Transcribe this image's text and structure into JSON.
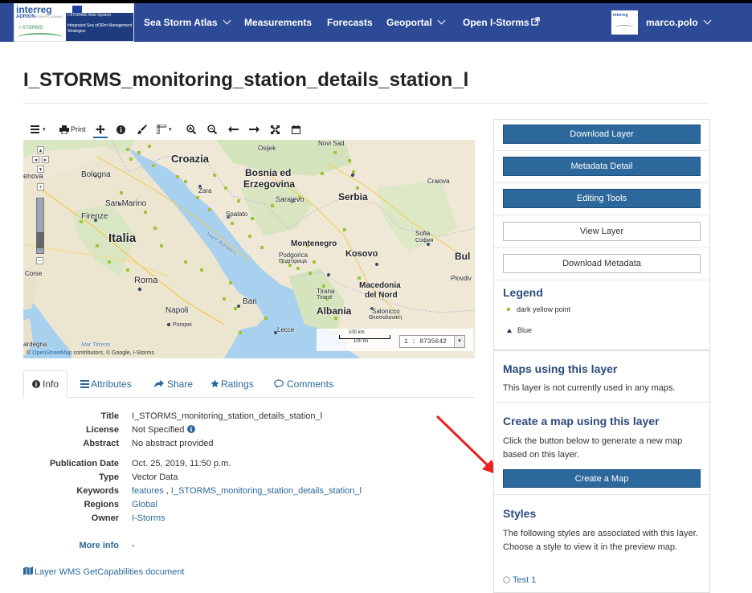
{
  "nav": {
    "logo": {
      "interreg": "interreg",
      "adrion": "ADRION",
      "adrion_sub": "ADRIATIC-IONIAN",
      "istorms": "I-STORMS",
      "line1": "I-STORMS Web System",
      "line2": "Integrated Sea stORm Management Strategies"
    },
    "items": [
      {
        "label": "Sea Storm Atlas",
        "dropdown": true
      },
      {
        "label": "Measurements",
        "dropdown": false
      },
      {
        "label": "Forecasts",
        "dropdown": false
      },
      {
        "label": "Geoportal",
        "dropdown": true
      },
      {
        "label": "Open I-Storms",
        "dropdown": false,
        "icon": "external-link-icon"
      }
    ],
    "user": {
      "name": "marco.polo",
      "avatar_text": "interreg"
    },
    "bar_color": "#2c4a96"
  },
  "page": {
    "title": "I_STORMS_monitoring_station_details_station_l"
  },
  "toolbar": {
    "menu_icon": "bars-icon",
    "print_label": "Print",
    "icons": [
      "pan-icon",
      "info-icon",
      "brush-icon",
      "measure-icon",
      "zoom-in-icon",
      "zoom-out-icon",
      "arrow-left-icon",
      "arrow-right-icon",
      "fullscreen-icon",
      "calendar-icon"
    ]
  },
  "map": {
    "labels": {
      "croazia": "Croazia",
      "bosnia": "Bosnia ed",
      "erzegovina": "Erzegovina",
      "serbia": "Serbia",
      "italia": "Italia",
      "montenegro": "Montenegro",
      "kosovo": "Kosovo",
      "albania": "Albania",
      "macedonia": "Macedonia",
      "del_nord": "del Nord",
      "bologna": "Bologna",
      "firenze": "Firenze",
      "san_marino": "San Marino",
      "roma": "Roma",
      "napoli": "Napoli",
      "bari": "Bari",
      "lecce": "Lecce",
      "pompei": "Pompei",
      "sarajevo": "Sarajevo",
      "split": "Spalato",
      "zara": "Zara",
      "podgorica": "Podgorica",
      "podgorica_cyr": "Подгорица",
      "tirana": "Tirana",
      "tirane": "Tiranë",
      "salonicco": "Salonicco",
      "salonicco_gr": "Θεσσαλονίκη",
      "sofia": "Sofia",
      "sofia_cyr": "София",
      "plovdiv": "Plovdiv",
      "craiova": "Craiova",
      "novi_sad": "Novi Sad",
      "mare_adriatico": "Mare Adriatico",
      "mar_tirreno": "Mar Tirreno",
      "corse": "Corse",
      "genova": "enova",
      "bul": "Bul",
      "sardegna": "ardegna",
      "osijek": "Osijek"
    },
    "scale": {
      "km": "100 km",
      "mi": "100 mi",
      "ratio": "1 : 8735642"
    },
    "attribution_source": "OpenStreetMap",
    "attribution": " contributors, © Google, I-Storms",
    "attribution_prefix": "©",
    "point_color": "#9fc63a"
  },
  "tabs": [
    {
      "label": "Info",
      "icon": "info-circle-icon",
      "active": true
    },
    {
      "label": "Attributes",
      "icon": "list-icon",
      "active": false
    },
    {
      "label": "Share",
      "icon": "share-icon",
      "active": false
    },
    {
      "label": "Ratings",
      "icon": "star-icon",
      "active": false
    },
    {
      "label": "Comments",
      "icon": "comment-icon",
      "active": false
    }
  ],
  "details": {
    "title": {
      "label": "Title",
      "value": "I_STORMS_monitoring_station_details_station_l"
    },
    "license": {
      "label": "License",
      "value": "Not Specified"
    },
    "abstract": {
      "label": "Abstract",
      "value": "No abstract provided"
    },
    "publication_date": {
      "label": "Publication Date",
      "value": "Oct. 25, 2019, 11:50 p.m."
    },
    "type": {
      "label": "Type",
      "value": "Vector Data"
    },
    "keywords": {
      "label": "Keywords",
      "values": [
        "features",
        "I_STORMS_monitoring_station_details_station_l"
      ],
      "separator": " , "
    },
    "regions": {
      "label": "Regions",
      "value": "Global"
    },
    "owner": {
      "label": "Owner",
      "value": "I-Storms"
    },
    "more_info": {
      "label": "More info",
      "value": "-"
    }
  },
  "getcapabilities": "Layer WMS GetCapabilities document",
  "sidebar": {
    "buttons": {
      "download_layer": "Download Layer",
      "metadata_detail": "Metadata Detail",
      "editing_tools": "Editing Tools",
      "view_layer": "View Layer",
      "download_metadata": "Download Metadata"
    },
    "legend": {
      "title": "Legend",
      "items": [
        "dark yellow point",
        "Blue"
      ]
    },
    "maps_using": {
      "title": "Maps using this layer",
      "text": "This layer is not currently used in any maps."
    },
    "create_map": {
      "title": "Create a map using this layer",
      "text": "Click the button below to generate a new map based on this layer.",
      "button": "Create a Map"
    },
    "styles": {
      "title": "Styles",
      "text": "The following styles are associated with this layer. Choose a style to view it in the preview map.",
      "first_option": "Test 1"
    },
    "primary_color": "#2c689c"
  }
}
